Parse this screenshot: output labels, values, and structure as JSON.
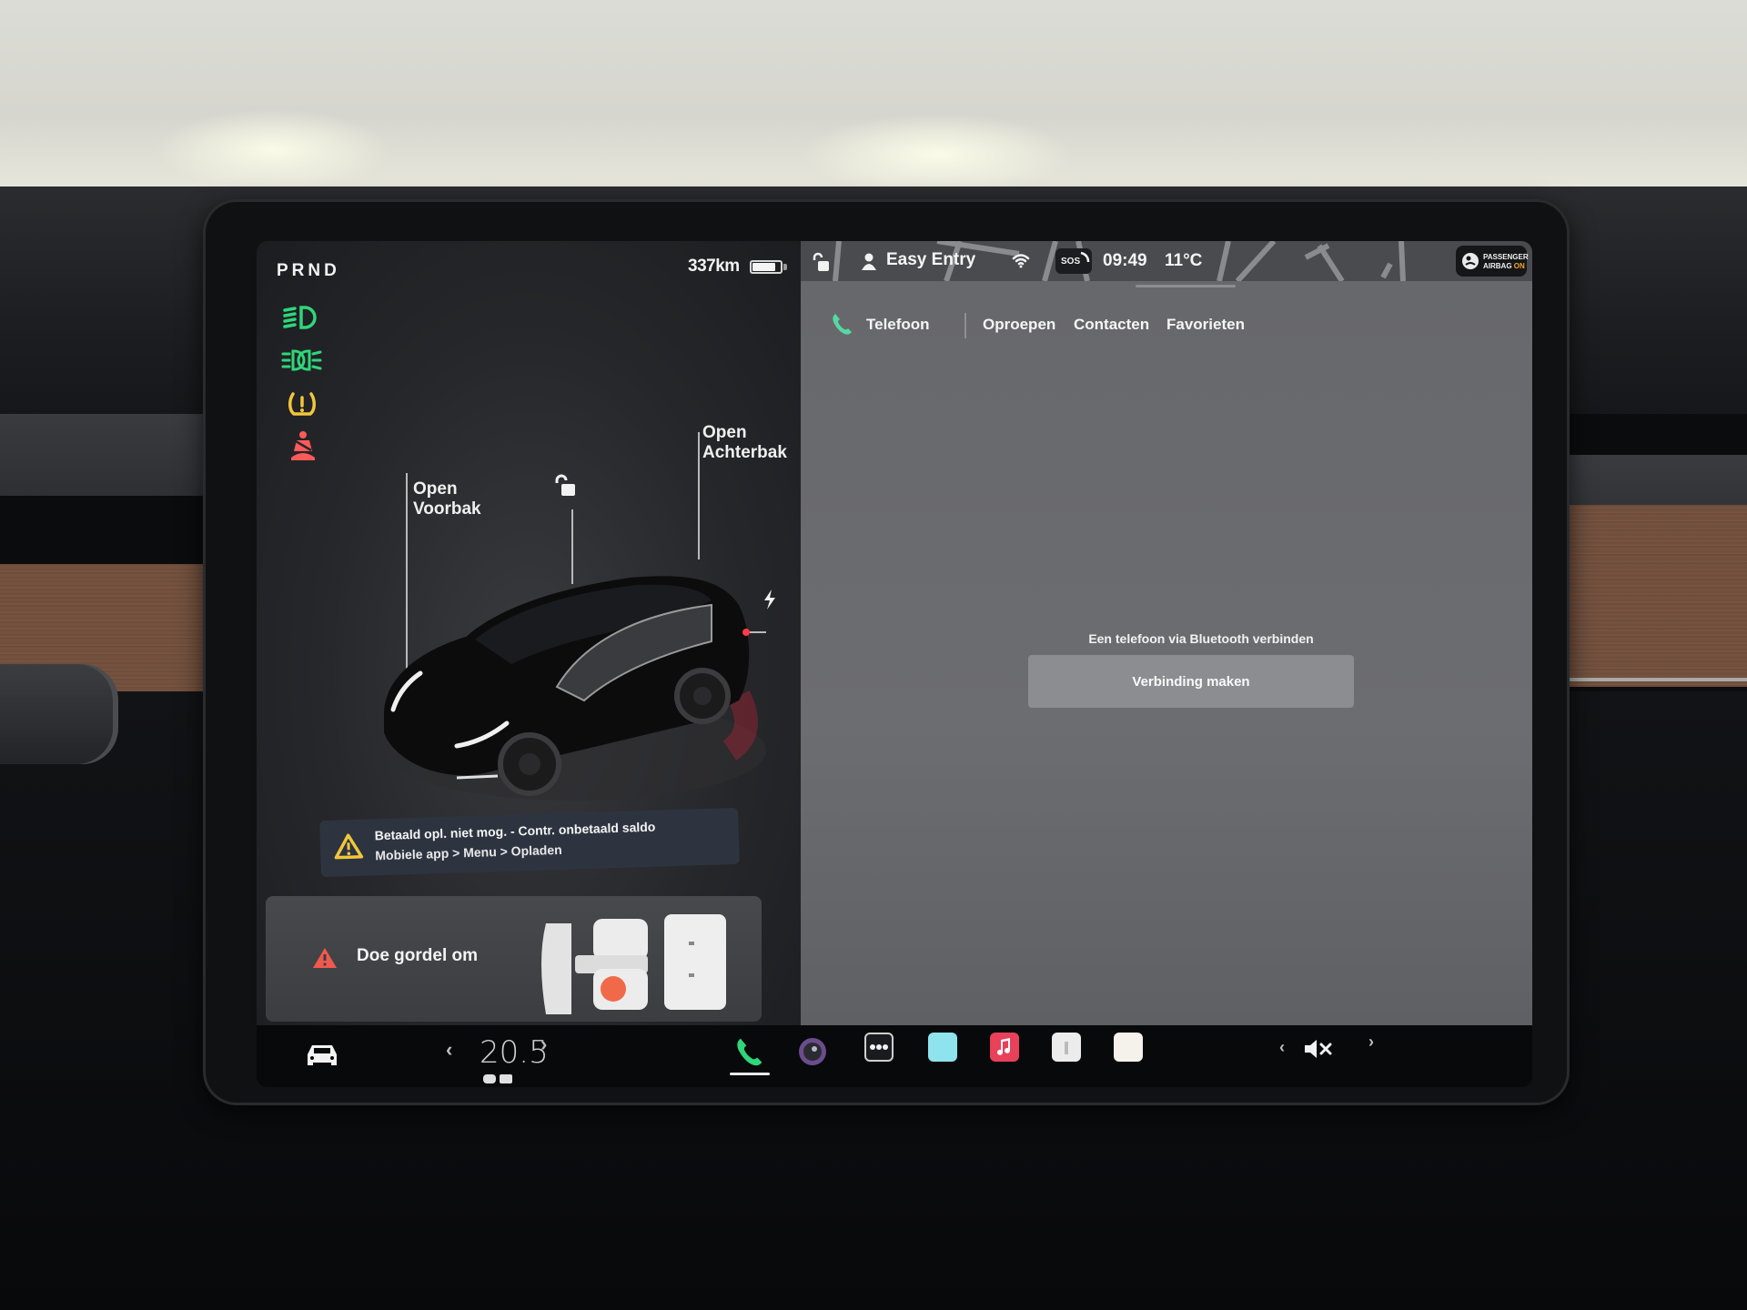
{
  "left_panel": {
    "gear_selector": "PRND",
    "range": "337km",
    "battery_level_percent": 85,
    "telltales": [
      {
        "icon": "low-beam-headlight-icon",
        "color": "#2fd67a"
      },
      {
        "icon": "parking-lights-icon",
        "color": "#2fd67a"
      },
      {
        "icon": "tire-pressure-warning-icon",
        "color": "#f2c63c"
      },
      {
        "icon": "seatbelt-warning-icon",
        "color": "#ff5a5a"
      }
    ],
    "callouts": {
      "frunk": {
        "line1": "Open",
        "line2": "Voorbak"
      },
      "trunk": {
        "line1": "Open",
        "line2": "Achterbak"
      },
      "lock_icon": "unlock-icon",
      "charge_icon": "lightning-bolt-icon"
    },
    "charging_warning": {
      "line1": "Betaald opl. niet mog. - Contr. onbetaald saldo",
      "line2": "Mobiele app > Menu > Opladen"
    },
    "seatbelt_alert": {
      "label": "Doe gordel om"
    }
  },
  "status_bar": {
    "lock_icon": "unlock-icon",
    "profile_name": "Easy Entry",
    "wifi_icon": "wifi-icon",
    "sos_label": "SOS",
    "time": "09:49",
    "temperature": "11°C",
    "airbag": {
      "line1": "PASSENGER",
      "line2_prefix": "AIRBAG",
      "line2_state": "ON"
    }
  },
  "phone_app": {
    "title": "Telefoon",
    "tabs": [
      "Oproepen",
      "Contacten",
      "Favorieten"
    ],
    "message": "Een telefoon via Bluetooth verbinden",
    "connect_button": "Verbinding maken"
  },
  "dock": {
    "cabin_temp": "20.5",
    "apps": [
      "phone",
      "camera",
      "more",
      "app-launcher",
      "music",
      "calendar",
      "notes"
    ],
    "volume_state": "muted",
    "colors": {
      "phone": "#2fd67a",
      "music": "#e8415a",
      "launcher": "#8fe3ee"
    }
  }
}
